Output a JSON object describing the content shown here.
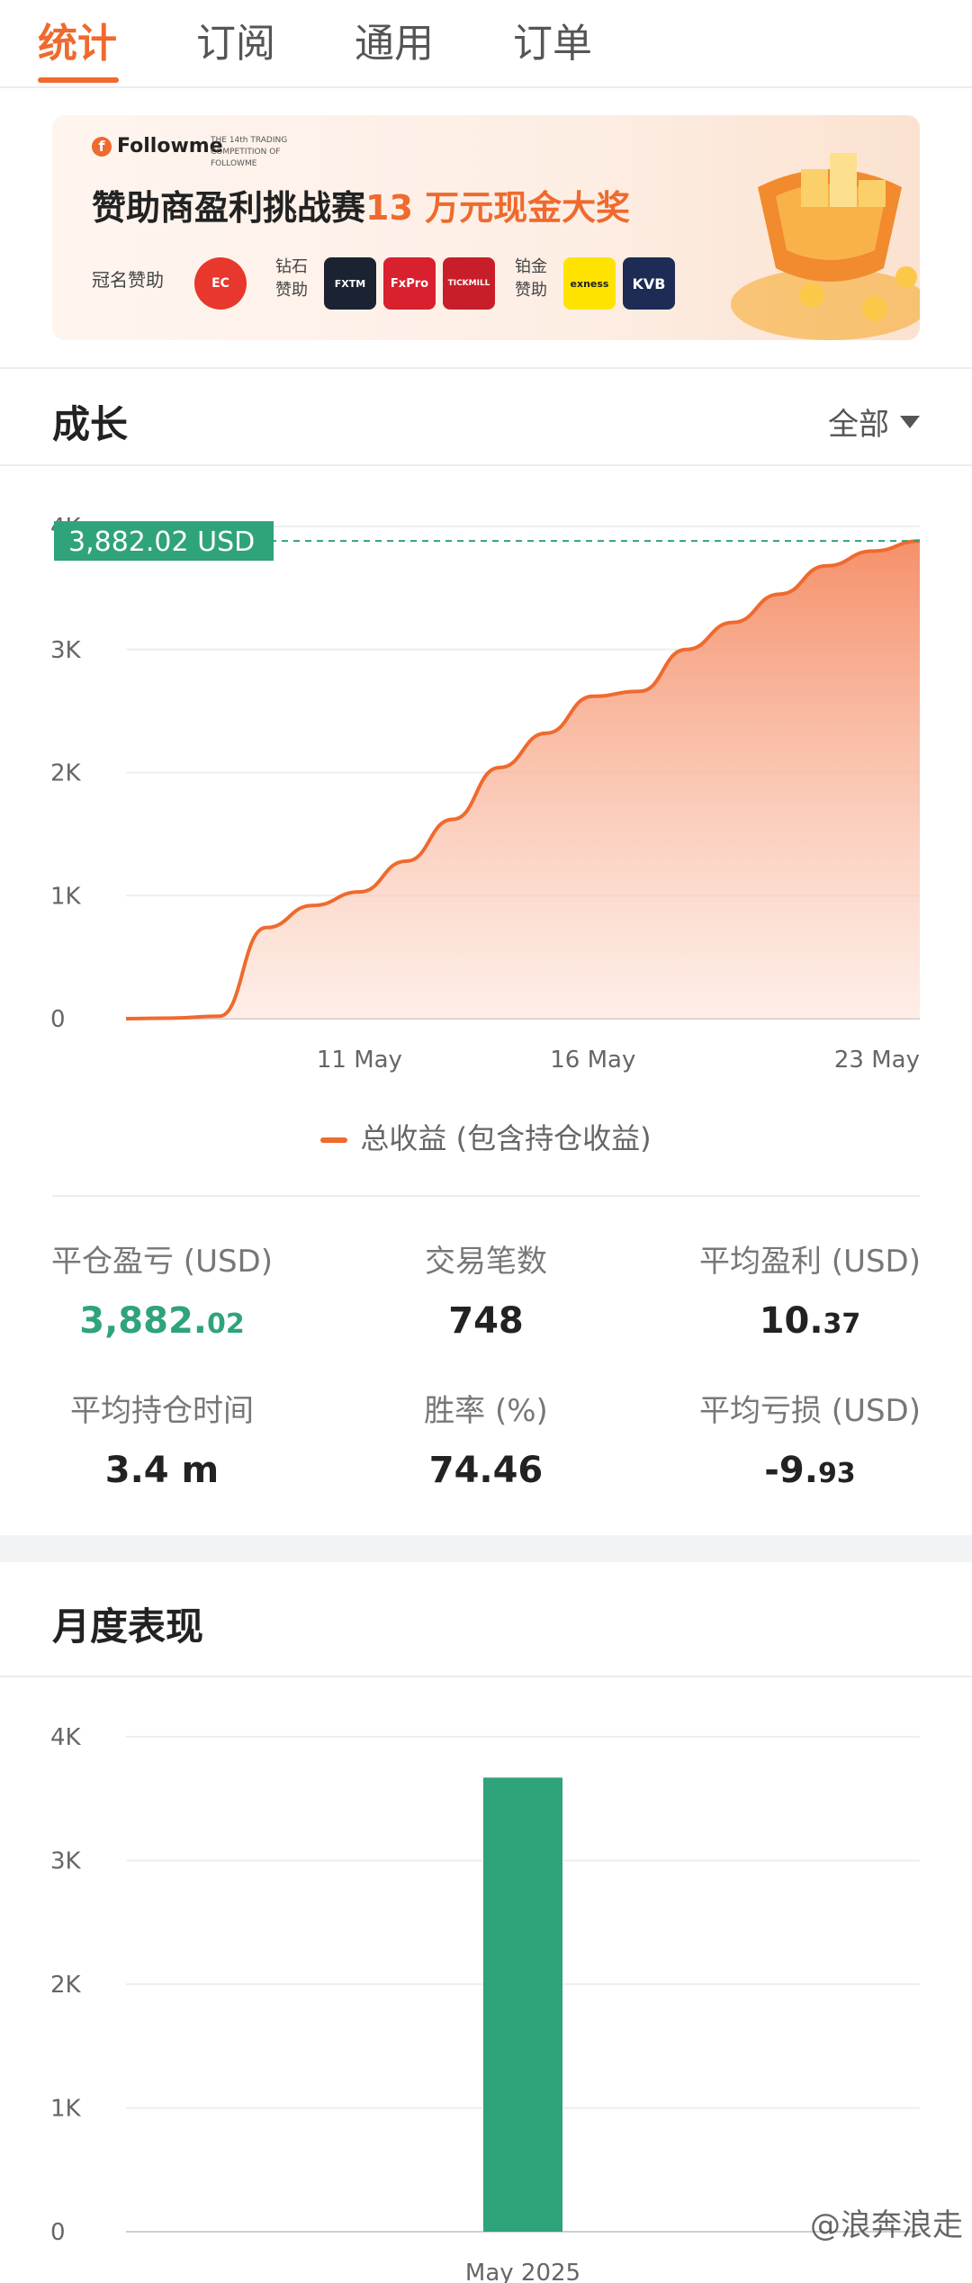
{
  "tabs": [
    {
      "label": "统计",
      "active": true
    },
    {
      "label": "订阅",
      "active": false
    },
    {
      "label": "通用",
      "active": false
    },
    {
      "label": "订单",
      "active": false
    }
  ],
  "banner": {
    "brand": "Followme",
    "brand_sub": "THE 14th TRADING COMPETITION OF FOLLOWME",
    "title_prefix": "赞助商盈利挑战赛",
    "title_highlight": "13 万元现金大奖",
    "title_sponsor_label": "冠名赞助",
    "diamond_label": "钻石赞助",
    "platinum_label": "铂金赞助",
    "logos": [
      "EC",
      "FXTM",
      "FxPro",
      "TICKMILL",
      "exness",
      "KVB"
    ]
  },
  "growth": {
    "title": "成长",
    "filter": "全部",
    "current_label": "3,882.02 USD",
    "legend": "总收益 (包含持仓收益)"
  },
  "chart_data": [
    {
      "type": "area",
      "title": "",
      "xlabel": "",
      "ylabel": "",
      "ylim": [
        0,
        4000
      ],
      "yticks": [
        "0",
        "1K",
        "2K",
        "3K",
        "4K"
      ],
      "xticks": [
        "11 May",
        "16 May",
        "23 May"
      ],
      "x": [
        "May 6",
        "May 7",
        "May 8",
        "May 9",
        "May 10",
        "May 11",
        "May 12",
        "May 13",
        "May 14",
        "May 15",
        "May 16",
        "May 17",
        "May 18",
        "May 19",
        "May 20",
        "May 21",
        "May 22",
        "May 23"
      ],
      "series": [
        {
          "name": "总收益 (包含持仓收益)",
          "values": [
            0,
            5,
            20,
            740,
            920,
            1030,
            1280,
            1620,
            2040,
            2320,
            2620,
            2660,
            3000,
            3220,
            3450,
            3680,
            3800,
            3882.02
          ]
        }
      ],
      "reference_line": 3882.02,
      "grid": true,
      "legend_position": "bottom"
    },
    {
      "type": "bar",
      "title": "",
      "xlabel": "",
      "ylabel": "",
      "ylim": [
        0,
        4000
      ],
      "yticks": [
        "0",
        "1K",
        "2K",
        "3K",
        "4K"
      ],
      "categories": [
        "May 2025"
      ],
      "values": [
        3670
      ],
      "grid": true
    }
  ],
  "stats": [
    {
      "label": "平仓盈亏 (USD)",
      "int": "3,882.",
      "dec": "02",
      "green": true
    },
    {
      "label": "交易笔数",
      "int": "748",
      "dec": "",
      "green": false
    },
    {
      "label": "平均盈利 (USD)",
      "int": "10.",
      "dec": "37",
      "green": false
    },
    {
      "label": "平均持仓时间",
      "int": "3.4 m",
      "dec": "",
      "green": false
    },
    {
      "label": "胜率 (%)",
      "int": "74.46",
      "dec": "",
      "green": false
    },
    {
      "label": "平均亏损 (USD)",
      "int": "-9.",
      "dec": "93",
      "green": false
    }
  ],
  "monthly": {
    "title": "月度表现"
  },
  "watermark": "@浪奔浪走",
  "colors": {
    "accent": "#ef6a2e",
    "green": "#2fa37a",
    "bar": "#2fa37a"
  }
}
